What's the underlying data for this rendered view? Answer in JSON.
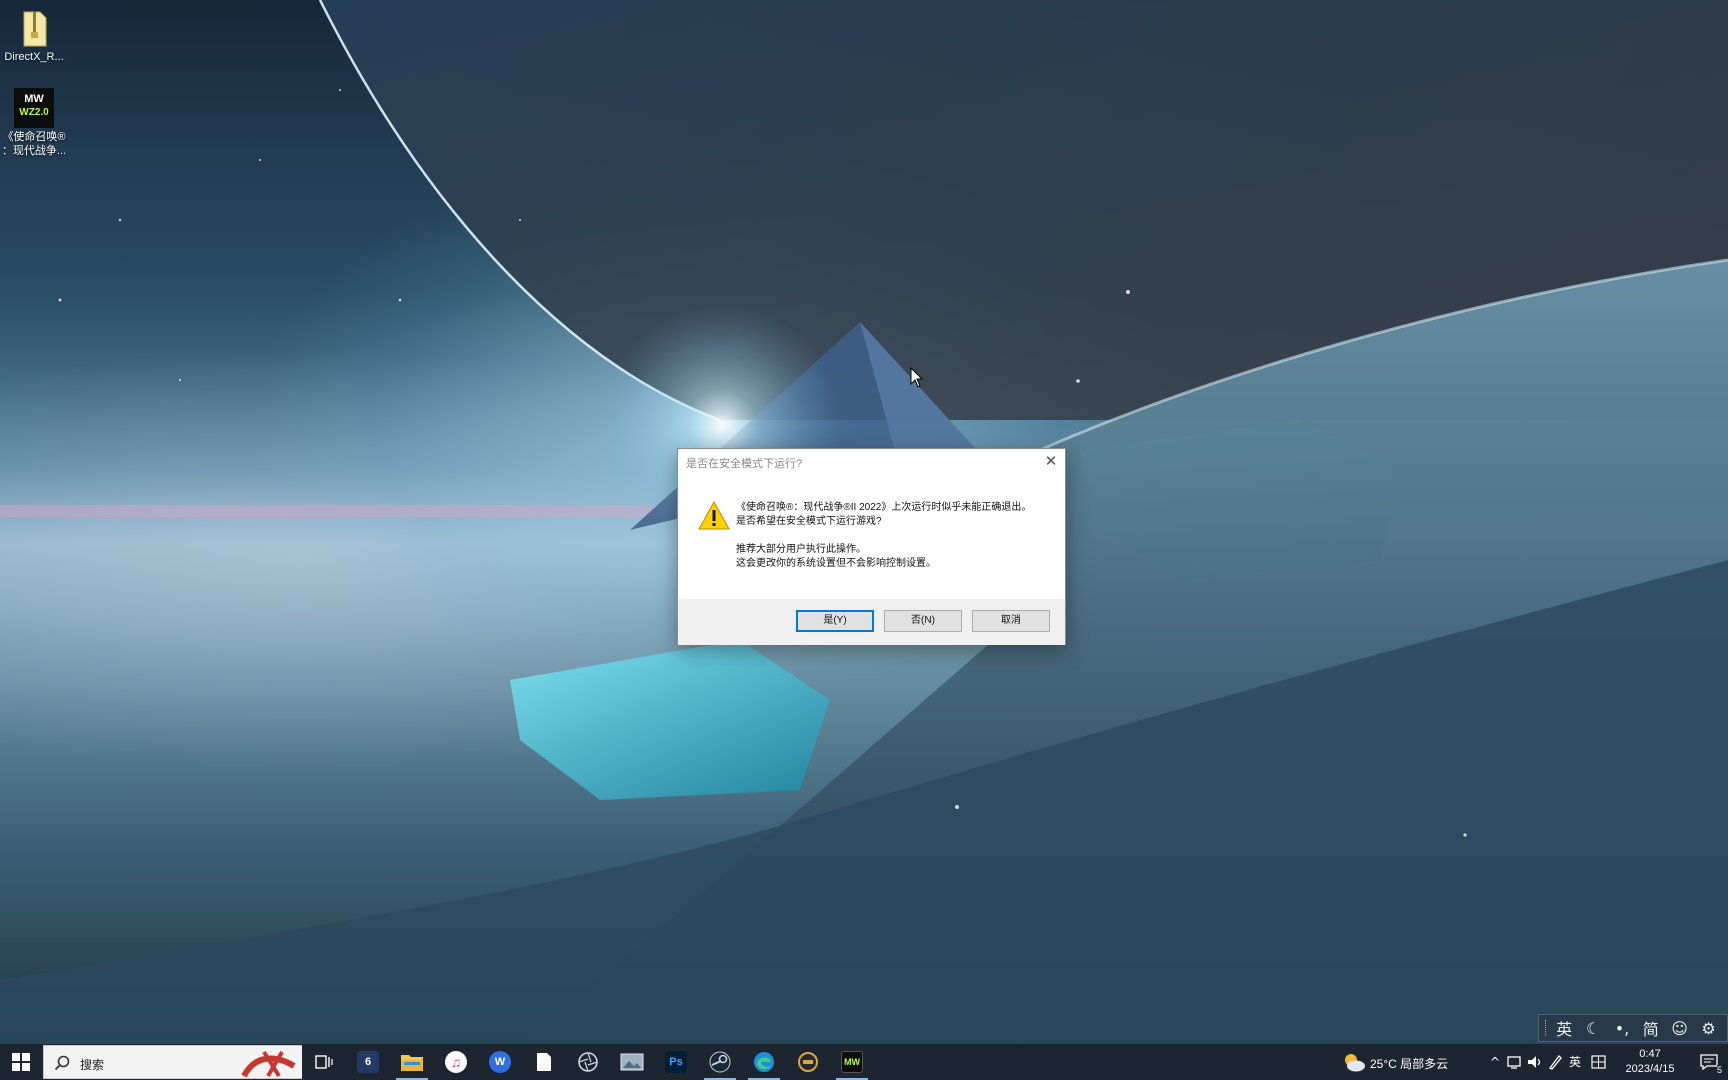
{
  "desktop": {
    "icons": [
      {
        "label": "DirectX_R...",
        "icon": "zip-folder-icon"
      },
      {
        "label_line1": "《使命召唤®",
        "label_line2": "：现代战争...",
        "icon": "mw2-game-icon",
        "badge_text": "MW",
        "badge_sub": "WZ2.0"
      }
    ]
  },
  "dialog": {
    "title": "是否在安全模式下运行?",
    "close_glyph": "✕",
    "message_line1": "《使命召唤®：现代战争®II 2022》上次运行时似乎未能正确退出。",
    "message_line2": "是否希望在安全模式下运行游戏?",
    "message_line3": "推荐大部分用户执行此操作。",
    "message_line4": "这会更改你的系统设置但不会影响控制设置。",
    "buttons": {
      "yes": "是(Y)",
      "no": "否(N)",
      "cancel": "取消"
    }
  },
  "ime": {
    "items": [
      "英",
      "☾",
      "•,",
      "简",
      "☺",
      "⚙"
    ]
  },
  "taskbar": {
    "search_placeholder": "搜索",
    "apps": [
      {
        "name": "task-view",
        "label": ""
      },
      {
        "name": "app-6",
        "label": "6"
      },
      {
        "name": "file-explorer",
        "label": ""
      },
      {
        "name": "itunes",
        "label": "♫"
      },
      {
        "name": "app-w",
        "label": "W"
      },
      {
        "name": "notepad",
        "label": ""
      },
      {
        "name": "app-circle",
        "label": ""
      },
      {
        "name": "app-photo",
        "label": ""
      },
      {
        "name": "photoshop",
        "label": "Ps"
      },
      {
        "name": "steam",
        "label": ""
      },
      {
        "name": "edge",
        "label": ""
      },
      {
        "name": "app-game",
        "label": ""
      },
      {
        "name": "mw2",
        "label": "MW"
      }
    ],
    "weather": "25°C 局部多云",
    "tray": {
      "chevron": "^",
      "input_lang": "英",
      "clock_time": "0:47",
      "clock_date": "2023/4/15",
      "notification_count": "5"
    }
  },
  "colors": {
    "accent": "#0078d7",
    "taskbar_bg": "#1c2530",
    "dialog_footer": "#f0f0f0"
  }
}
